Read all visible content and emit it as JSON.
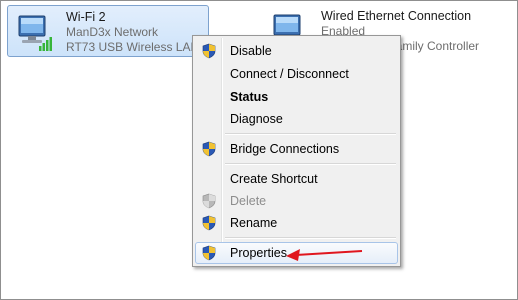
{
  "adapters": [
    {
      "name": "Wi-Fi 2",
      "network": "ManD3x Network",
      "device": "RT73 USB Wireless LAN C",
      "selected": true,
      "icon": "wireless-network-icon"
    },
    {
      "name": "Wired Ethernet Connection",
      "network": "Enabled",
      "device": "BE Family Controller",
      "selected": false,
      "icon": "wired-network-icon"
    }
  ],
  "context_menu": {
    "items": [
      {
        "label": "Disable",
        "shield": true
      },
      {
        "label": "Connect / Disconnect",
        "shield": false
      },
      {
        "label": "Status",
        "shield": false,
        "bold": true
      },
      {
        "label": "Diagnose",
        "shield": false
      },
      {
        "label": "Bridge Connections",
        "shield": true
      },
      {
        "label": "Create Shortcut",
        "shield": false
      },
      {
        "label": "Delete",
        "shield": true,
        "disabled": true
      },
      {
        "label": "Rename",
        "shield": true
      },
      {
        "label": "Properties",
        "shield": true,
        "highlighted": true
      }
    ]
  },
  "colors": {
    "annotation_arrow": "#e0161e",
    "selection": "#cde3fa",
    "uac_shield_blue": "#2a59b5",
    "uac_shield_yellow": "#f1c232"
  }
}
